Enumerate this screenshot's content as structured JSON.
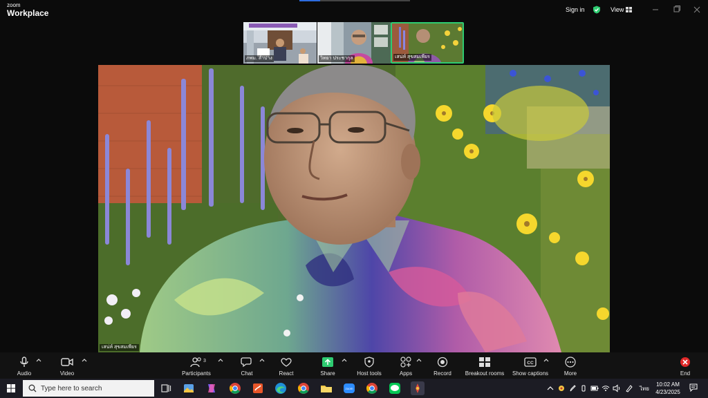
{
  "titlebar": {
    "brand_small": "zoom",
    "brand_large": "Workplace",
    "sign_in": "Sign in",
    "view": "View",
    "colors": {
      "shield": "#2ecc71",
      "background": "#0b0b0b"
    }
  },
  "thumbnails": [
    {
      "name": "ภพม. ลำปาง"
    },
    {
      "name": "วิทยา ประชากุล"
    },
    {
      "name": "เสน่ห์ สุขสมเพียร",
      "active": true
    }
  ],
  "main_video": {
    "name": "เสน่ห์ สุขสมเพียร"
  },
  "toolbar": {
    "audio": "Audio",
    "video": "Video",
    "participants": "Participants",
    "participants_count": "3",
    "chat": "Chat",
    "react": "React",
    "share": "Share",
    "host_tools": "Host tools",
    "apps": "Apps",
    "record": "Record",
    "breakout_rooms": "Breakout rooms",
    "show_captions": "Show captions",
    "more": "More",
    "end": "End",
    "colors": {
      "share": "#2ecc71",
      "end": "#e02828"
    }
  },
  "taskbar": {
    "search_placeholder": "Type here to search",
    "language": "ไทย",
    "time": "10:02 AM",
    "date": "4/23/2025"
  }
}
